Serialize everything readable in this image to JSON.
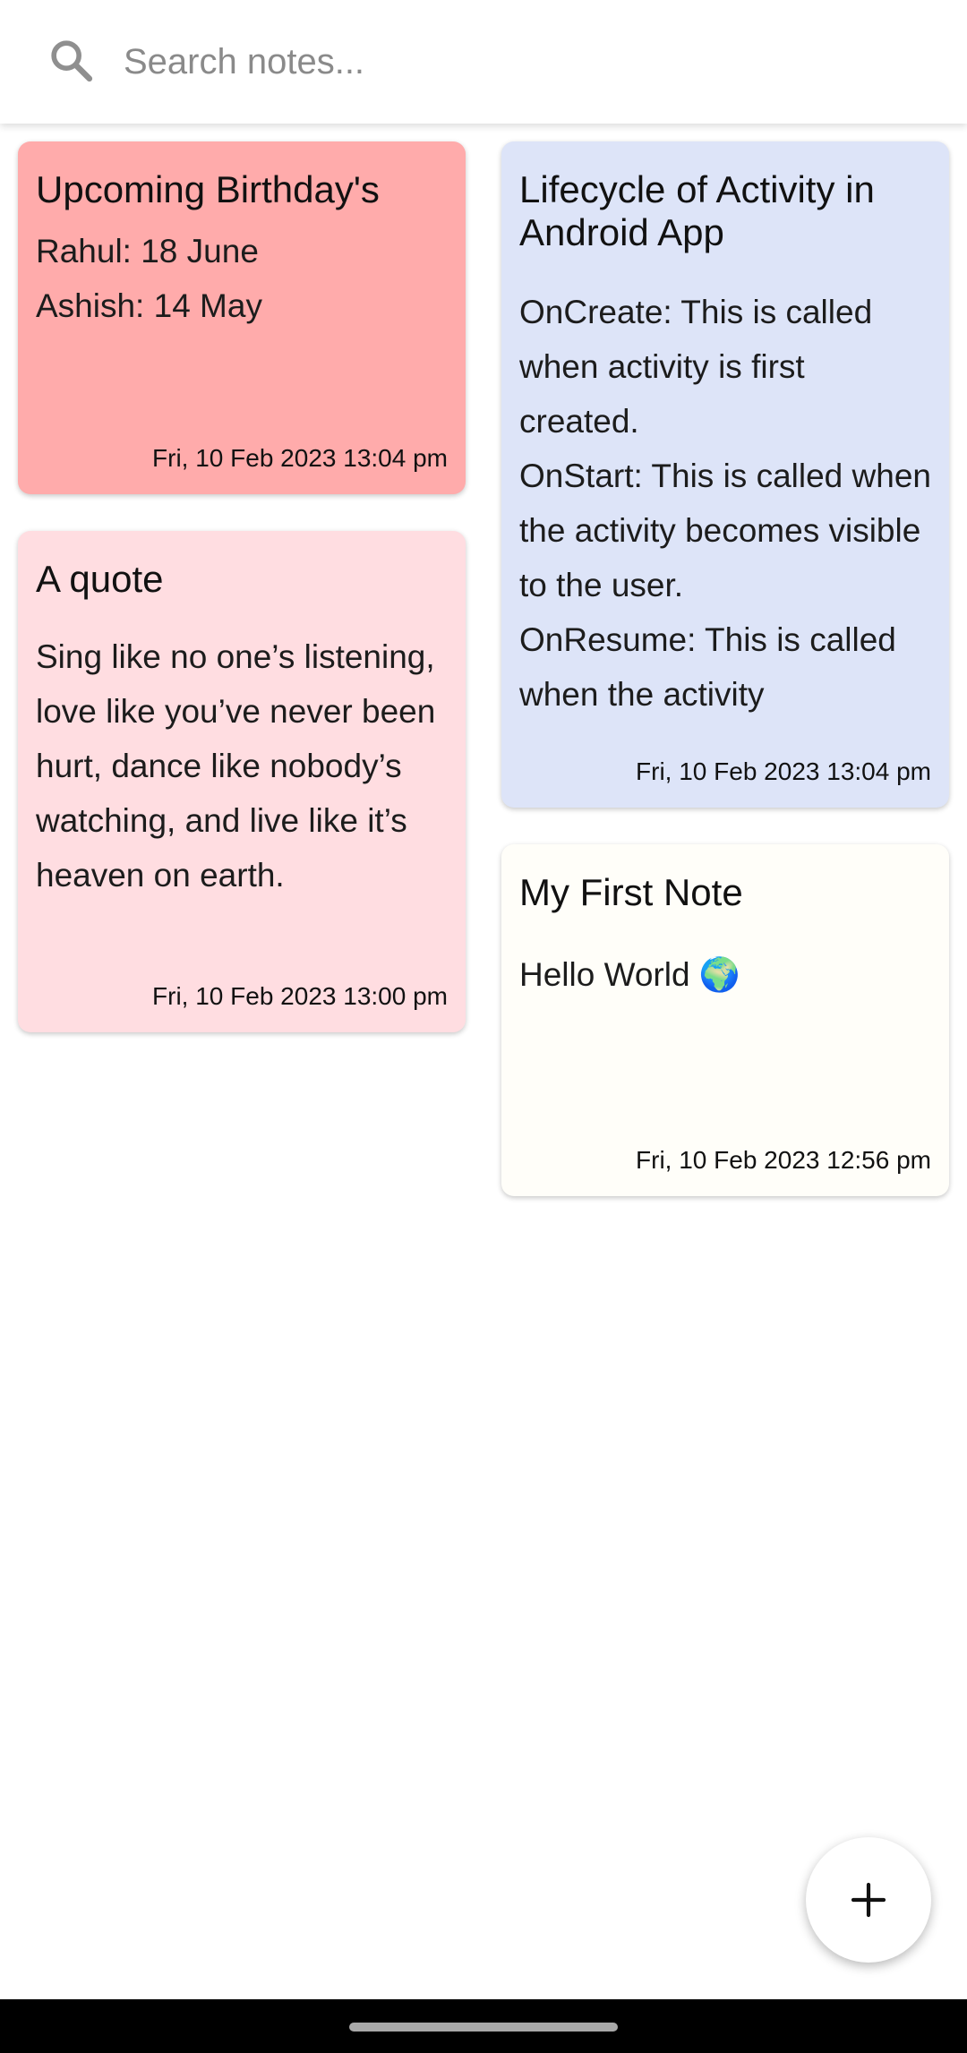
{
  "search": {
    "placeholder": "Search notes...",
    "value": ""
  },
  "notes": [
    {
      "title": "Upcoming Birthday's",
      "body": "Rahul: 18 June\nAshish: 14 May",
      "date": "Fri, 10 Feb 2023 13:04 pm",
      "color": "#FFABAB"
    },
    {
      "title": "A quote",
      "body": "Sing like no one’s listening, love like you’ve never been hurt, dance like nobody’s watching, and live like it’s heaven on earth.",
      "date": "Fri, 10 Feb 2023 13:00 pm",
      "color": "#FFDDE1"
    },
    {
      "title": "Lifecycle of Activity in Android App",
      "body": "OnCreate: This is called when activity is first created.\nOnStart: This is called when the activity becomes visible to the user.\nOnResume: This is called when the activity",
      "date": "Fri, 10 Feb 2023 13:04 pm",
      "color": "#DDE4F8"
    },
    {
      "title": "My First Note",
      "body": "Hello World 🌍",
      "date": "Fri, 10 Feb 2023 12:56 pm",
      "color": "#FFFEF9"
    }
  ],
  "fab": {
    "icon": "plus-icon"
  },
  "colors": {
    "background": "#FFFFFF",
    "nav_bar": "#000000"
  }
}
